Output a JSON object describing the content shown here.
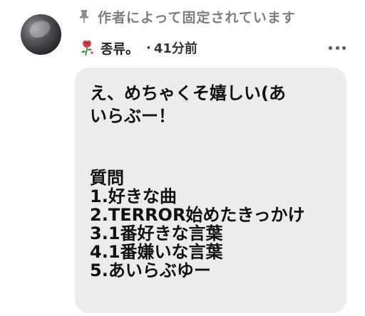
{
  "post": {
    "pinned_label": "作者によって固定されています",
    "username": "종류。",
    "separator": "·",
    "time": "41分前",
    "more_icon": "more-horizontal-icon",
    "avatar_icon": "avatar",
    "flower_icon": "rose-icon"
  },
  "message": {
    "lines": [
      "え、めちゃくそ嬉しい(あ",
      "いらぶー！",
      "",
      "",
      "質問",
      "1.好きな曲",
      "2.TERROR始めたきっかけ",
      "3.1番好きな言葉",
      "4.1番嫌いな言葉",
      "5.あいらぶゆー"
    ]
  },
  "colors": {
    "bubble_bg": "#ececee",
    "muted_text": "#7d7d7d",
    "text": "#111111"
  }
}
